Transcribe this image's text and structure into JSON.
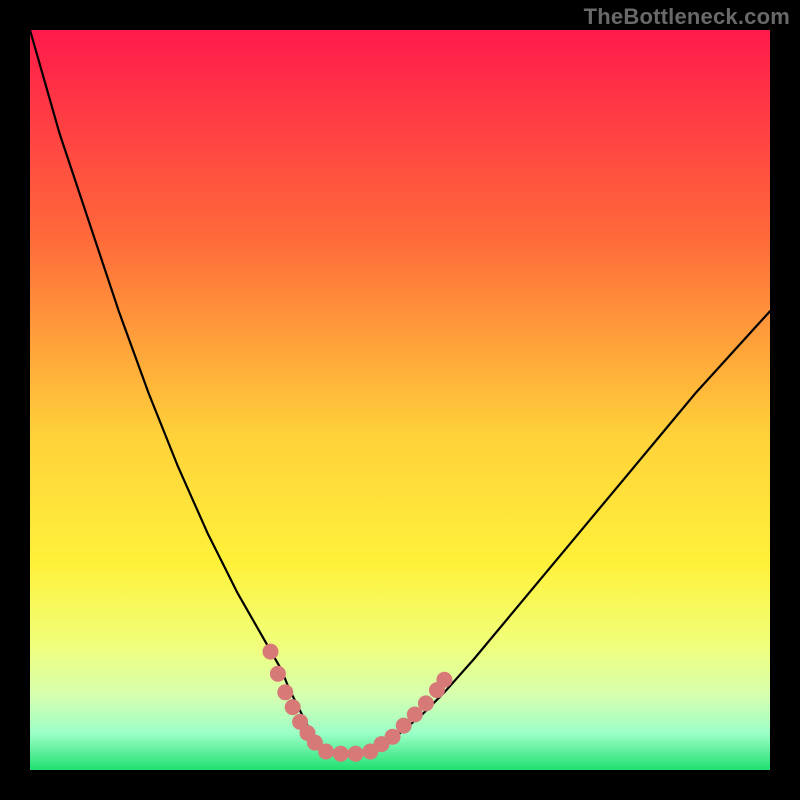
{
  "watermark": "TheBottleneck.com",
  "chart_data": {
    "type": "line",
    "title": "",
    "xlabel": "",
    "ylabel": "",
    "xlim": [
      0,
      100
    ],
    "ylim": [
      0,
      100
    ],
    "gradient_stops": [
      {
        "offset": 0,
        "color": "#ff1a4b"
      },
      {
        "offset": 28,
        "color": "#ff6a3a"
      },
      {
        "offset": 55,
        "color": "#ffd23a"
      },
      {
        "offset": 72,
        "color": "#fff13a"
      },
      {
        "offset": 83,
        "color": "#f0ff7a"
      },
      {
        "offset": 90,
        "color": "#d6ffb0"
      },
      {
        "offset": 95,
        "color": "#9cffc8"
      },
      {
        "offset": 100,
        "color": "#20e070"
      }
    ],
    "series": [
      {
        "name": "bottleneck-curve",
        "color": "#000000",
        "width": 2.2,
        "x": [
          0,
          2,
          4,
          6,
          8,
          10,
          12,
          14,
          16,
          18,
          20,
          22,
          24,
          26,
          28,
          30,
          32,
          34,
          35,
          36,
          37,
          38,
          39,
          40,
          42,
          44,
          46,
          48,
          50,
          53,
          56,
          60,
          65,
          70,
          75,
          80,
          85,
          90,
          95,
          100
        ],
        "y": [
          100,
          93,
          86,
          80,
          74,
          68,
          62,
          56.5,
          51,
          46,
          41,
          36.5,
          32,
          28,
          24,
          20.5,
          17,
          13.5,
          11,
          9,
          7,
          5,
          3.5,
          2.5,
          2,
          2,
          2.5,
          3.5,
          5,
          7.5,
          10.5,
          15,
          21,
          27,
          33,
          39,
          45,
          51,
          56.5,
          62
        ]
      }
    ],
    "highlight_markers": {
      "name": "bottleneck-free-zone",
      "color": "#d77a77",
      "radius": 8,
      "points": [
        {
          "x": 32.5,
          "y": 16
        },
        {
          "x": 33.5,
          "y": 13
        },
        {
          "x": 34.5,
          "y": 10.5
        },
        {
          "x": 35.5,
          "y": 8.5
        },
        {
          "x": 36.5,
          "y": 6.5
        },
        {
          "x": 37.5,
          "y": 5
        },
        {
          "x": 38.5,
          "y": 3.7
        },
        {
          "x": 40,
          "y": 2.5
        },
        {
          "x": 42,
          "y": 2.2
        },
        {
          "x": 44,
          "y": 2.2
        },
        {
          "x": 46,
          "y": 2.5
        },
        {
          "x": 47.5,
          "y": 3.5
        },
        {
          "x": 49,
          "y": 4.5
        },
        {
          "x": 50.5,
          "y": 6
        },
        {
          "x": 52,
          "y": 7.5
        },
        {
          "x": 53.5,
          "y": 9
        },
        {
          "x": 55,
          "y": 10.8
        },
        {
          "x": 56,
          "y": 12.2
        }
      ]
    }
  }
}
